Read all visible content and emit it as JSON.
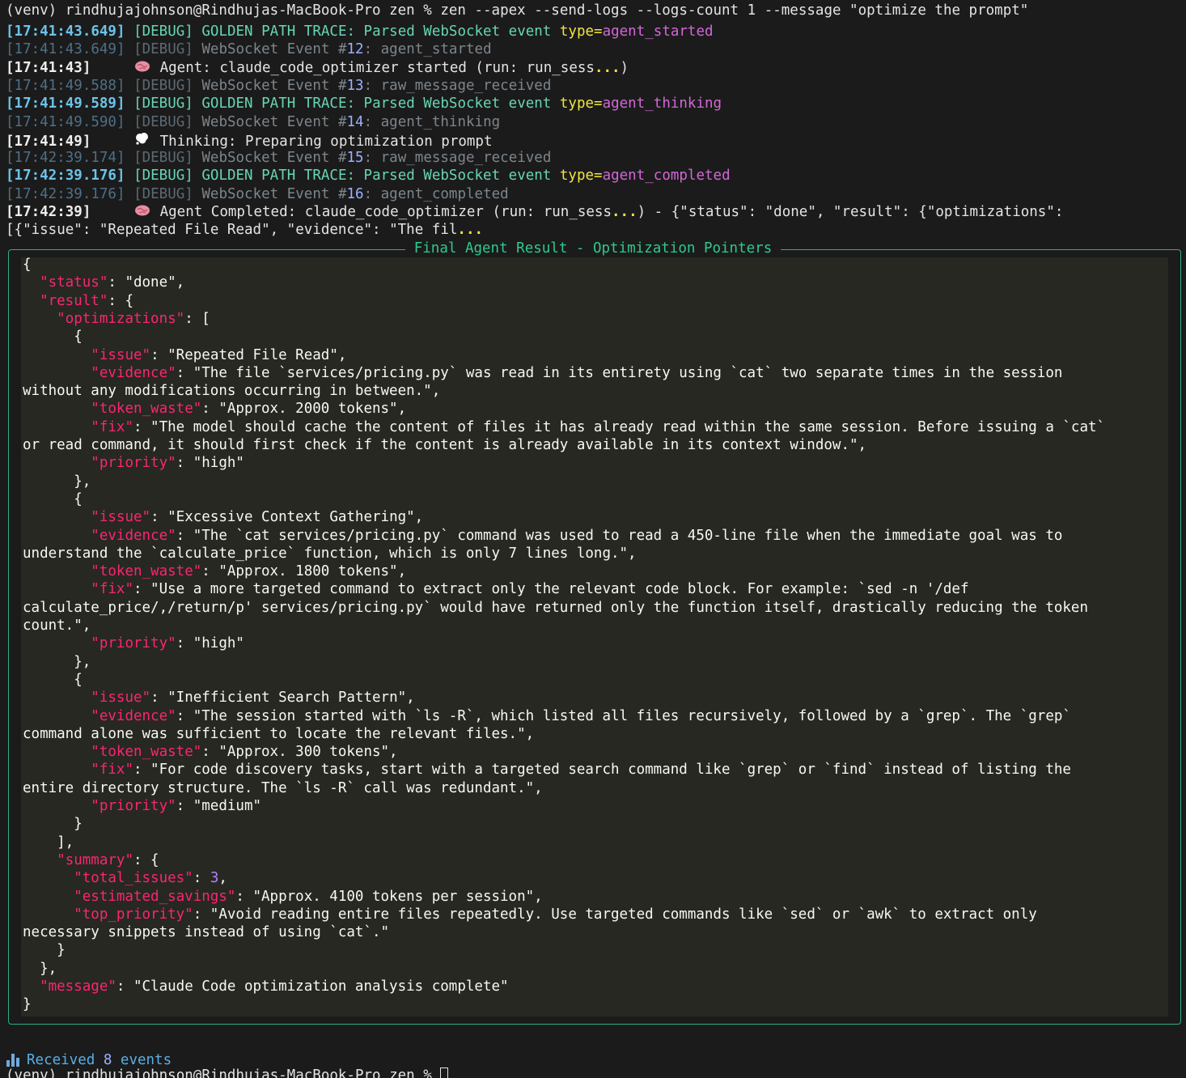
{
  "prompt_line": "(venv) rindhujajohnson@Rindhujas-MacBook-Pro zen % zen --apex --send-logs --logs-count 1 --message \"optimize the prompt\"",
  "logs": [
    {
      "ts": "[17:41:43.649]",
      "level": "[DEBUG]",
      "prefix": "GOLDEN PATH TRACE: Parsed WebSocket event ",
      "type_key": "type=",
      "type_val": "agent_started"
    },
    {
      "ts": "[17:41:43.649]",
      "level": "[DEBUG]",
      "prefix": "WebSocket Event #",
      "num": "12",
      "msg": ": agent_started"
    },
    {
      "ts": "[17:41:43]",
      "icon": "brain-icon",
      "msg": "Agent: claude_code_optimizer started (run: run_sess",
      "ell": "...",
      "tail": ")"
    },
    {
      "ts": "[17:41:49.588]",
      "level": "[DEBUG]",
      "prefix": "WebSocket Event #",
      "num": "13",
      "msg": ": raw_message_received"
    },
    {
      "ts": "[17:41:49.589]",
      "level": "[DEBUG]",
      "prefix": "GOLDEN PATH TRACE: Parsed WebSocket event ",
      "type_key": "type=",
      "type_val": "agent_thinking"
    },
    {
      "ts": "[17:41:49.590]",
      "level": "[DEBUG]",
      "prefix": "WebSocket Event #",
      "num": "14",
      "msg": ": agent_thinking"
    },
    {
      "ts": "[17:41:49]",
      "icon": "thought-bubble-icon",
      "msg": "Thinking: Preparing optimization prompt"
    },
    {
      "ts": "[17:42:39.174]",
      "level": "[DEBUG]",
      "prefix": "WebSocket Event #",
      "num": "15",
      "msg": ": raw_message_received"
    },
    {
      "ts": "[17:42:39.176]",
      "level": "[DEBUG]",
      "prefix": "GOLDEN PATH TRACE: Parsed WebSocket event ",
      "type_key": "type=",
      "type_val": "agent_completed"
    },
    {
      "ts": "[17:42:39.176]",
      "level": "[DEBUG]",
      "prefix": "WebSocket Event #",
      "num": "16",
      "msg": ": agent_completed"
    },
    {
      "ts": "[17:42:39]",
      "icon": "brain-icon",
      "msg": "Agent Completed: claude_code_optimizer (run: run_sess",
      "ell": "...",
      "tail": ") - {\"status\": \"done\", \"result\": {\"optimizations\":"
    }
  ],
  "wrap_line": {
    "text": "[{\"issue\": \"Repeated File Read\", \"evidence\": \"The fil",
    "ell": "..."
  },
  "panel_title": "Final Agent Result - Optimization Pointers",
  "json_lines": [
    [
      [
        "p",
        "{"
      ]
    ],
    [
      [
        "p",
        "  "
      ],
      [
        "k",
        "\"status\""
      ],
      [
        "p",
        ": \"done\","
      ]
    ],
    [
      [
        "p",
        "  "
      ],
      [
        "k",
        "\"result\""
      ],
      [
        "p",
        ": {"
      ]
    ],
    [
      [
        "p",
        "    "
      ],
      [
        "k",
        "\"optimizations\""
      ],
      [
        "p",
        ": ["
      ]
    ],
    [
      [
        "p",
        "      {"
      ]
    ],
    [
      [
        "p",
        "        "
      ],
      [
        "k",
        "\"issue\""
      ],
      [
        "p",
        ": \"Repeated File Read\","
      ]
    ],
    [
      [
        "p",
        "        "
      ],
      [
        "k",
        "\"evidence\""
      ],
      [
        "p",
        ": \"The file `services/pricing.py` was read in its entirety using `cat` two separate times in the session"
      ]
    ],
    [
      [
        "p",
        "without any modifications occurring in between.\","
      ]
    ],
    [
      [
        "p",
        "        "
      ],
      [
        "k",
        "\"token_waste\""
      ],
      [
        "p",
        ": \"Approx. 2000 tokens\","
      ]
    ],
    [
      [
        "p",
        "        "
      ],
      [
        "k",
        "\"fix\""
      ],
      [
        "p",
        ": \"The model should cache the content of files it has already read within the same session. Before issuing a `cat`"
      ]
    ],
    [
      [
        "p",
        "or read command, it should first check if the content is already available in its context window.\","
      ]
    ],
    [
      [
        "p",
        "        "
      ],
      [
        "k",
        "\"priority\""
      ],
      [
        "p",
        ": \"high\""
      ]
    ],
    [
      [
        "p",
        "      },"
      ]
    ],
    [
      [
        "p",
        "      {"
      ]
    ],
    [
      [
        "p",
        "        "
      ],
      [
        "k",
        "\"issue\""
      ],
      [
        "p",
        ": \"Excessive Context Gathering\","
      ]
    ],
    [
      [
        "p",
        "        "
      ],
      [
        "k",
        "\"evidence\""
      ],
      [
        "p",
        ": \"The `cat services/pricing.py` command was used to read a 450-line file when the immediate goal was to"
      ]
    ],
    [
      [
        "p",
        "understand the `calculate_price` function, which is only 7 lines long.\","
      ]
    ],
    [
      [
        "p",
        "        "
      ],
      [
        "k",
        "\"token_waste\""
      ],
      [
        "p",
        ": \"Approx. 1800 tokens\","
      ]
    ],
    [
      [
        "p",
        "        "
      ],
      [
        "k",
        "\"fix\""
      ],
      [
        "p",
        ": \"Use a more targeted command to extract only the relevant code block. For example: `sed -n '/def"
      ]
    ],
    [
      [
        "p",
        "calculate_price/,/return/p' services/pricing.py` would have returned only the function itself, drastically reducing the token"
      ]
    ],
    [
      [
        "p",
        "count.\","
      ]
    ],
    [
      [
        "p",
        "        "
      ],
      [
        "k",
        "\"priority\""
      ],
      [
        "p",
        ": \"high\""
      ]
    ],
    [
      [
        "p",
        "      },"
      ]
    ],
    [
      [
        "p",
        "      {"
      ]
    ],
    [
      [
        "p",
        "        "
      ],
      [
        "k",
        "\"issue\""
      ],
      [
        "p",
        ": \"Inefficient Search Pattern\","
      ]
    ],
    [
      [
        "p",
        "        "
      ],
      [
        "k",
        "\"evidence\""
      ],
      [
        "p",
        ": \"The session started with `ls -R`, which listed all files recursively, followed by a `grep`. The `grep`"
      ]
    ],
    [
      [
        "p",
        "command alone was sufficient to locate the relevant files.\","
      ]
    ],
    [
      [
        "p",
        "        "
      ],
      [
        "k",
        "\"token_waste\""
      ],
      [
        "p",
        ": \"Approx. 300 tokens\","
      ]
    ],
    [
      [
        "p",
        "        "
      ],
      [
        "k",
        "\"fix\""
      ],
      [
        "p",
        ": \"For code discovery tasks, start with a targeted search command like `grep` or `find` instead of listing the"
      ]
    ],
    [
      [
        "p",
        "entire directory structure. The `ls -R` call was redundant.\","
      ]
    ],
    [
      [
        "p",
        "        "
      ],
      [
        "k",
        "\"priority\""
      ],
      [
        "p",
        ": \"medium\""
      ]
    ],
    [
      [
        "p",
        "      }"
      ]
    ],
    [
      [
        "p",
        "    ],"
      ]
    ],
    [
      [
        "p",
        "    "
      ],
      [
        "k",
        "\"summary\""
      ],
      [
        "p",
        ": {"
      ]
    ],
    [
      [
        "p",
        "      "
      ],
      [
        "k",
        "\"total_issues\""
      ],
      [
        "p",
        ": "
      ],
      [
        "n",
        "3"
      ],
      [
        "p",
        ","
      ]
    ],
    [
      [
        "p",
        "      "
      ],
      [
        "k",
        "\"estimated_savings\""
      ],
      [
        "p",
        ": \"Approx. 4100 tokens per session\","
      ]
    ],
    [
      [
        "p",
        "      "
      ],
      [
        "k",
        "\"top_priority\""
      ],
      [
        "p",
        ": \"Avoid reading entire files repeatedly. Use targeted commands like `sed` or `awk` to extract only"
      ]
    ],
    [
      [
        "p",
        "necessary snippets instead of using `cat`.\""
      ]
    ],
    [
      [
        "p",
        "    }"
      ]
    ],
    [
      [
        "p",
        "  },"
      ]
    ],
    [
      [
        "p",
        "  "
      ],
      [
        "k",
        "\"message\""
      ],
      [
        "p",
        ": \"Claude Code optimization analysis complete\""
      ]
    ],
    [
      [
        "p",
        "}"
      ]
    ]
  ],
  "footer": {
    "received_prefix": "Received ",
    "count": "8",
    "suffix": " events"
  },
  "next_prompt": "(venv) rindhujajohnson@Rindhujas-MacBook-Pro zen % ",
  "colors": {
    "panel_border": "#2fae7f",
    "code_bg": "#272822",
    "key": "#f92672",
    "number": "#ae81ff"
  }
}
